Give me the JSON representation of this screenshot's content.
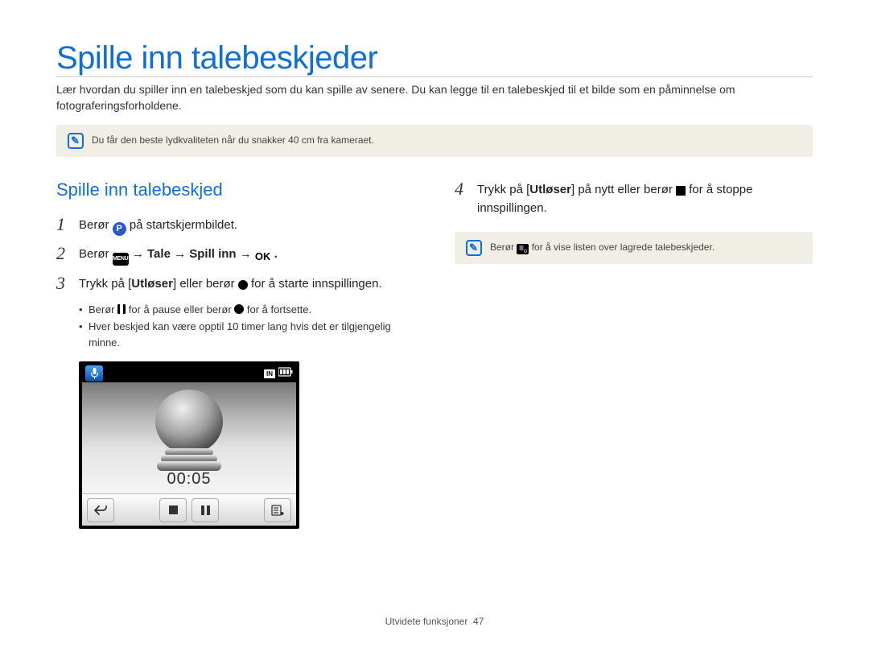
{
  "title": "Spille inn talebeskjeder",
  "intro": "Lær hvordan du spiller inn en talebeskjed som du kan spille av senere. Du kan legge til en talebeskjed til et bilde som en påminnelse om fotograferingsforholdene.",
  "note_top": "Du får den beste lydkvaliteten når du snakker 40 cm fra kameraet.",
  "left": {
    "subheading": "Spille inn talebeskjed",
    "step1": {
      "text": "Berør ",
      "suffix": " på startskjermbildet."
    },
    "step2": {
      "prefix": "Berør ",
      "chain1": " → Tale → Spill inn → ",
      "suffix": "."
    },
    "step3": {
      "prefix": "Trykk på [",
      "shutter": "Utløser",
      "mid": "] eller berør ",
      "suffix": " for å starte innspillingen."
    },
    "bullet1_a": "Berør ",
    "bullet1_b": " for å pause eller berør ",
    "bullet1_c": " for å fortsette.",
    "bullet2": "Hver beskjed kan være opptil 10 timer lang hvis det er tilgjengelig minne."
  },
  "right": {
    "step4": {
      "prefix": "Trykk på [",
      "shutter": "Utløser",
      "mid": "] på nytt eller berør ",
      "suffix": " for å stoppe innspillingen."
    },
    "note_a": "Berør ",
    "note_b": " for å vise listen over lagrede talebeskjeder."
  },
  "screen": {
    "indicator": "IN",
    "timer": "00:05"
  },
  "icons": {
    "p": "P",
    "menu": "MENU",
    "ok": "OK"
  },
  "footer": {
    "section": "Utvidete funksjoner",
    "page": "47"
  }
}
